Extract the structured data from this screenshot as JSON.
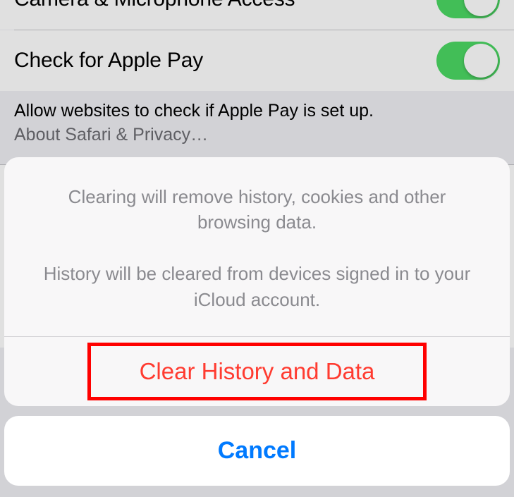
{
  "settings": {
    "rows": [
      {
        "label": "Camera & Microphone Access",
        "toggle": true
      },
      {
        "label": "Check for Apple Pay",
        "toggle": true
      }
    ],
    "footer_primary": "Allow websites to check if Apple Pay is set up.",
    "footer_link": "About Safari & Privacy…"
  },
  "actionsheet": {
    "message_line1": "Clearing will remove history, cookies and other browsing data.",
    "message_line2": "History will be cleared from devices signed in to your iCloud account.",
    "destructive_label": "Clear History and Data",
    "cancel_label": "Cancel"
  }
}
